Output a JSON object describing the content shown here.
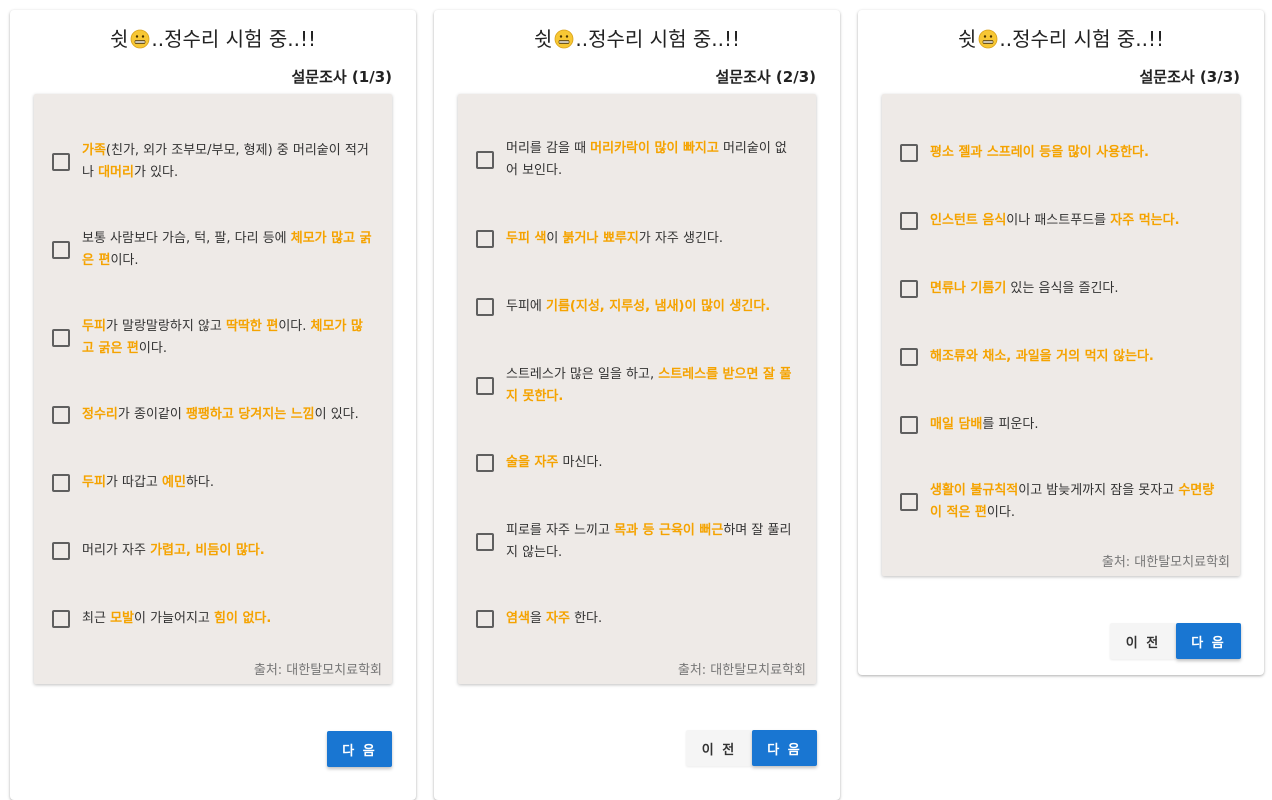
{
  "panels": [
    {
      "title_prefix": "쉿",
      "title_suffix": "..정수리 시험 중..!!",
      "step": "설문조사 (1/3)",
      "items": [
        {
          "parts": [
            {
              "t": "가족",
              "h": true
            },
            {
              "t": "(친가, 외가 조부모/부모, 형제) 중 머리숱이 적거나 ",
              "h": false
            },
            {
              "t": "대머리",
              "h": true
            },
            {
              "t": "가 있다.",
              "h": false
            }
          ]
        },
        {
          "parts": [
            {
              "t": "보통 사람보다 가슴, 턱, 팔, 다리 등에 ",
              "h": false
            },
            {
              "t": "체모가 많고 굵은 편",
              "h": true
            },
            {
              "t": "이다.",
              "h": false
            }
          ]
        },
        {
          "parts": [
            {
              "t": "두피",
              "h": true
            },
            {
              "t": "가 말랑말랑하지 않고 ",
              "h": false
            },
            {
              "t": "딱딱한 편",
              "h": true
            },
            {
              "t": "이다. ",
              "h": false
            },
            {
              "t": "체모가 많고 굵은 편",
              "h": true
            },
            {
              "t": "이다.",
              "h": false
            }
          ]
        },
        {
          "parts": [
            {
              "t": "정수리",
              "h": true
            },
            {
              "t": "가 종이같이 ",
              "h": false
            },
            {
              "t": "팽팽하고 당겨지는 느낌",
              "h": true
            },
            {
              "t": "이 있다.",
              "h": false
            }
          ]
        },
        {
          "parts": [
            {
              "t": "두피",
              "h": true
            },
            {
              "t": "가 따갑고 ",
              "h": false
            },
            {
              "t": "예민",
              "h": true
            },
            {
              "t": "하다.",
              "h": false
            }
          ]
        },
        {
          "parts": [
            {
              "t": "머리가 자주 ",
              "h": false
            },
            {
              "t": "가렵고, 비듬이 많다.",
              "h": true
            }
          ]
        },
        {
          "parts": [
            {
              "t": "최근 ",
              "h": false
            },
            {
              "t": "모발",
              "h": true
            },
            {
              "t": "이 가늘어지고 ",
              "h": false
            },
            {
              "t": "힘이 없다.",
              "h": true
            }
          ]
        }
      ],
      "source": "출처: 대한탈모치료학회",
      "prev_label": "",
      "next_label": "다 음"
    },
    {
      "title_prefix": "쉿",
      "title_suffix": "..정수리 시험 중..!!",
      "step": "설문조사 (2/3)",
      "items": [
        {
          "parts": [
            {
              "t": "머리를 감을 때 ",
              "h": false
            },
            {
              "t": "머리카락이 많이 빠지고",
              "h": true
            },
            {
              "t": " 머리숱이 없어 보인다.",
              "h": false
            }
          ]
        },
        {
          "parts": [
            {
              "t": "두피 색",
              "h": true
            },
            {
              "t": "이 ",
              "h": false
            },
            {
              "t": "붉거나 뾰루지",
              "h": true
            },
            {
              "t": "가 자주 생긴다.",
              "h": false
            }
          ]
        },
        {
          "parts": [
            {
              "t": "두피에 ",
              "h": false
            },
            {
              "t": "기름(지성, 지루성, 냄새)이 많이 생긴다.",
              "h": true
            }
          ]
        },
        {
          "parts": [
            {
              "t": "스트레스가 많은 일을 하고, ",
              "h": false
            },
            {
              "t": "스트레스를 받으면 잘 풀지 못한다.",
              "h": true
            }
          ]
        },
        {
          "parts": [
            {
              "t": "술을 자주",
              "h": true
            },
            {
              "t": " 마신다.",
              "h": false
            }
          ]
        },
        {
          "parts": [
            {
              "t": "피로를 자주 느끼고 ",
              "h": false
            },
            {
              "t": "목과 등 근육이 뻐근",
              "h": true
            },
            {
              "t": "하며 잘 풀리지 않는다.",
              "h": false
            }
          ]
        },
        {
          "parts": [
            {
              "t": "염색",
              "h": true
            },
            {
              "t": "을 ",
              "h": false
            },
            {
              "t": "자주",
              "h": true
            },
            {
              "t": " 한다.",
              "h": false
            }
          ]
        }
      ],
      "source": "출처: 대한탈모치료학회",
      "prev_label": "이 전",
      "next_label": "다 음"
    },
    {
      "title_prefix": "쉿",
      "title_suffix": "..정수리 시험 중..!!",
      "step": "설문조사 (3/3)",
      "items": [
        {
          "parts": [
            {
              "t": "평소 젤과 스프레이 등을 많이 사용한다.",
              "h": true
            }
          ]
        },
        {
          "parts": [
            {
              "t": "인스턴트 음식",
              "h": true
            },
            {
              "t": "이나 패스트푸드를 ",
              "h": false
            },
            {
              "t": "자주 먹는다.",
              "h": true
            }
          ]
        },
        {
          "parts": [
            {
              "t": "면류나 기름기",
              "h": true
            },
            {
              "t": " 있는 음식을 즐긴다.",
              "h": false
            }
          ]
        },
        {
          "parts": [
            {
              "t": "해조류와 채소, 과일을 거의 먹지 않는다.",
              "h": true
            }
          ]
        },
        {
          "parts": [
            {
              "t": "매일 담배",
              "h": true
            },
            {
              "t": "를 피운다.",
              "h": false
            }
          ]
        },
        {
          "parts": [
            {
              "t": "생활이 불규칙적",
              "h": true
            },
            {
              "t": "이고 밤늦게까지 잠을 못자고 ",
              "h": false
            },
            {
              "t": "수면량이 적은 편",
              "h": true
            },
            {
              "t": "이다.",
              "h": false
            }
          ]
        }
      ],
      "source": "출처: 대한탈모치료학회",
      "prev_label": "이 전",
      "next_label": "다 음"
    }
  ]
}
